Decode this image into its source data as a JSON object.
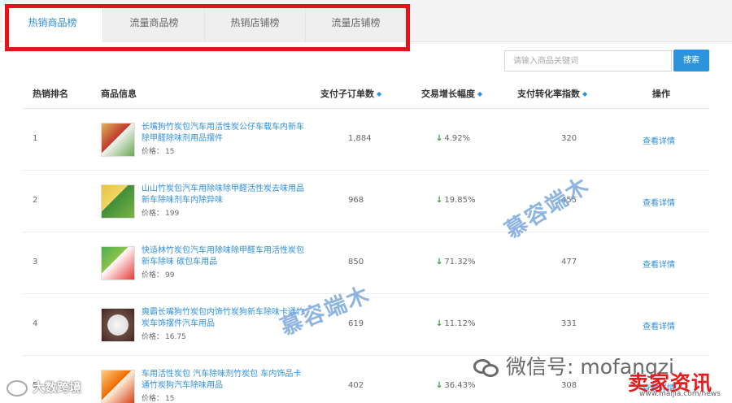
{
  "tabs": [
    {
      "label": "热销商品榜",
      "active": true
    },
    {
      "label": "流量商品榜",
      "active": false
    },
    {
      "label": "热销店铺榜",
      "active": false
    },
    {
      "label": "流量店铺榜",
      "active": false
    }
  ],
  "search": {
    "placeholder": "请输入商品关键词",
    "button_label": "搜索"
  },
  "table": {
    "headers": {
      "rank": "热销排名",
      "product": "商品信息",
      "orders": "支付子订单数",
      "growth": "交易增长幅度",
      "conversion": "支付转化率指数",
      "action": "操作"
    },
    "price_label": "价格：",
    "rows": [
      {
        "rank": "1",
        "name": "长嘴狗竹炭包汽车用活性炭公仔车载车内新车除甲醛除味剂用品摆件",
        "price": "15",
        "orders": "1,884",
        "growth_arrow": "↓",
        "growth": "4.92%",
        "conversion": "320",
        "action": "查看详情"
      },
      {
        "rank": "2",
        "name": "山山竹炭包汽车用除味除甲醛活性炭去味用品新车除味剂车内除异味",
        "price": "199",
        "orders": "968",
        "growth_arrow": "↓",
        "growth": "19.85%",
        "conversion": "455",
        "action": "查看详情"
      },
      {
        "rank": "3",
        "name": "快适林竹炭包汽车用除味除甲醛车用活性炭包新车除味 碳包车用品",
        "price": "99",
        "orders": "850",
        "growth_arrow": "↓",
        "growth": "71.32%",
        "conversion": "477",
        "action": "查看详情"
      },
      {
        "rank": "4",
        "name": "爽霸长嘴狗竹炭包内饰竹炭狗新车除味卡通竹炭车饰摆件汽车用品",
        "price": "16.75",
        "orders": "619",
        "growth_arrow": "↓",
        "growth": "11.12%",
        "conversion": "331",
        "action": "查看详情"
      },
      {
        "rank": "5",
        "name": "车用活性炭包 汽车除味剂竹炭包 车内饰品卡通竹炭狗汽车除味用品",
        "price": "15",
        "orders": "402",
        "growth_arrow": "↓",
        "growth": "36.43%",
        "conversion": "308",
        "action": "查看详情"
      }
    ]
  },
  "overlays": {
    "watermark1": "慕容端木",
    "watermark2": "慕容端木",
    "wechat": "微信号: mofangzi",
    "logo_left": "大数跨境",
    "logo_right": "卖家资讯",
    "logo_url": "www.maijia.com/news"
  }
}
